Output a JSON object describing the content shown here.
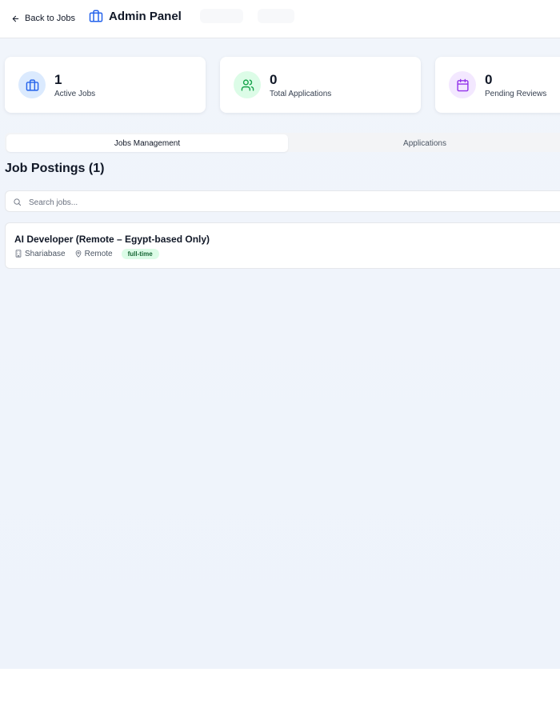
{
  "header": {
    "back_label": "Back to Jobs",
    "title": "Admin Panel"
  },
  "stats": [
    {
      "value": "1",
      "label": "Active Jobs",
      "icon": "briefcase-icon",
      "bg": "#dbeafe",
      "color": "#2563eb"
    },
    {
      "value": "0",
      "label": "Total Applications",
      "icon": "users-icon",
      "bg": "#dcfce7",
      "color": "#16a34a"
    },
    {
      "value": "0",
      "label": "Pending Reviews",
      "icon": "calendar-icon",
      "bg": "#f3e8ff",
      "color": "#9333ea"
    }
  ],
  "tabs": {
    "jobs_management": "Jobs Management",
    "applications": "Applications"
  },
  "section": {
    "title": "Job Postings (1)"
  },
  "search": {
    "placeholder": "Search jobs...",
    "value": ""
  },
  "jobs": [
    {
      "title": "AI Developer (Remote – Egypt-based Only)",
      "company": "Shariabase",
      "location": "Remote",
      "type": "full-time"
    }
  ],
  "colors": {
    "accent": "#2563eb",
    "badge_bg": "#dcfce7",
    "badge_text": "#166534"
  }
}
